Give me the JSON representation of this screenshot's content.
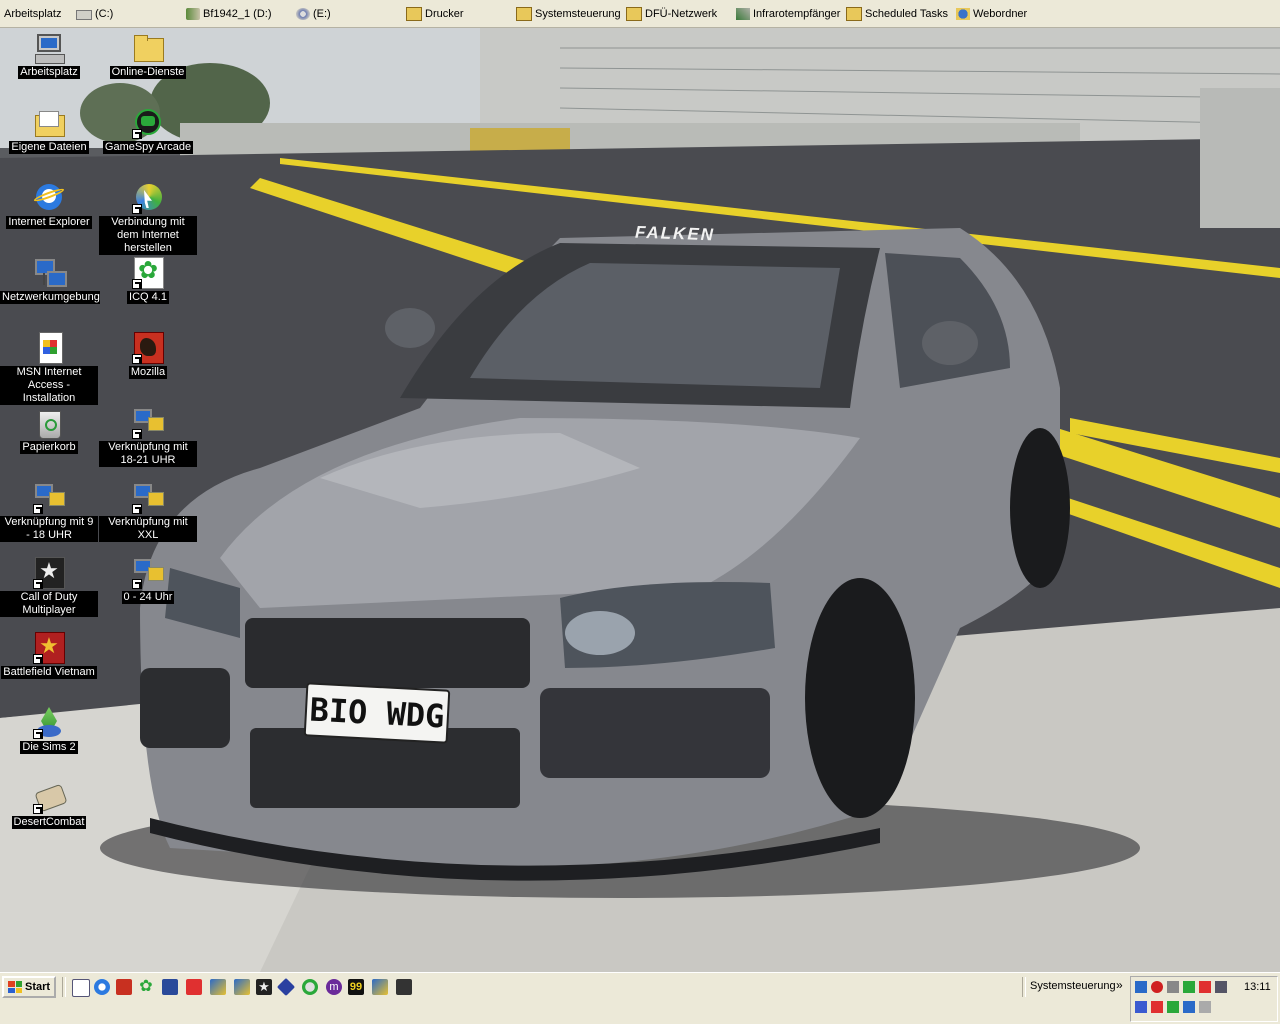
{
  "toolbar": {
    "items": [
      {
        "label": "Arbeitsplatz",
        "icon": "computer-icon"
      },
      {
        "label": "(C:)",
        "icon": "drive-icon"
      },
      {
        "label": "Bf1942_1 (D:)",
        "icon": "cd-drive-icon"
      },
      {
        "label": "(E:)",
        "icon": "cd-drive-icon"
      },
      {
        "label": "Drucker",
        "icon": "printer-folder-icon"
      },
      {
        "label": "Systemsteuerung",
        "icon": "control-panel-icon"
      },
      {
        "label": "DFÜ-Netzwerk",
        "icon": "dialup-folder-icon"
      },
      {
        "label": "Infrarotempfänger",
        "icon": "infrared-icon"
      },
      {
        "label": "Scheduled Tasks",
        "icon": "scheduled-tasks-icon"
      },
      {
        "label": "Webordner",
        "icon": "web-folder-icon"
      }
    ]
  },
  "desktop": {
    "icons": [
      {
        "label": "Arbeitsplatz",
        "icon": "computer-icon"
      },
      {
        "label": "Online-Dienste",
        "icon": "folder-icon"
      },
      {
        "label": "Eigene Dateien",
        "icon": "open-folder-icon"
      },
      {
        "label": "GameSpy Arcade",
        "icon": "gamespy-icon"
      },
      {
        "label": "Internet Explorer",
        "icon": "internet-explorer-icon"
      },
      {
        "label": "Verbindung mit dem Internet herstellen",
        "icon": "connection-wizard-icon"
      },
      {
        "label": "Netzwerkumgebung",
        "icon": "network-icon"
      },
      {
        "label": "ICQ 4.1",
        "icon": "icq-flower-icon"
      },
      {
        "label": "MSN Internet Access - Installation",
        "icon": "msn-setup-icon"
      },
      {
        "label": "Mozilla",
        "icon": "mozilla-icon"
      },
      {
        "label": "Papierkorb",
        "icon": "recycle-bin-icon"
      },
      {
        "label": "Verknüpfung mit 18-21 UHR",
        "icon": "dialup-connection-icon"
      },
      {
        "label": "Verknüpfung mit 9 - 18 UHR",
        "icon": "dialup-connection-icon"
      },
      {
        "label": "Verknüpfung mit XXL",
        "icon": "dialup-connection-icon"
      },
      {
        "label": "Call of Duty Multiplayer",
        "icon": "call-of-duty-icon"
      },
      {
        "label": "0 - 24 Uhr",
        "icon": "dialup-connection-icon"
      },
      {
        "label": "Battlefield Vietnam",
        "icon": "battlefield-vietnam-icon"
      },
      {
        "label": "Die Sims 2",
        "icon": "sims2-icon"
      },
      {
        "label": "DesertCombat",
        "icon": "desert-combat-icon"
      }
    ]
  },
  "wallpaper": {
    "plate": "BIO WDG",
    "windshield_banner": "FALKEN"
  },
  "taskbar": {
    "start_label": "Start",
    "quicklaunch": [
      "notepad-icon",
      "ie-icon",
      "pdf-icon",
      "icq-icon",
      "winamp-icon",
      "acrobat-icon",
      "dialup-icon",
      "dialup-icon",
      "star-icon",
      "network-icon",
      "mozilla-icon",
      "messenger-icon",
      "99-icon",
      "dialup-icon",
      "game-icon"
    ],
    "open_item": "Systemsteuerung",
    "chevron": "»",
    "clock": "13:11"
  },
  "colors": {
    "taskbar_bg": "#ece9d8",
    "asphalt": "#4a4b50",
    "road_line": "#e8d12a",
    "car_body": "#8a8c92"
  }
}
